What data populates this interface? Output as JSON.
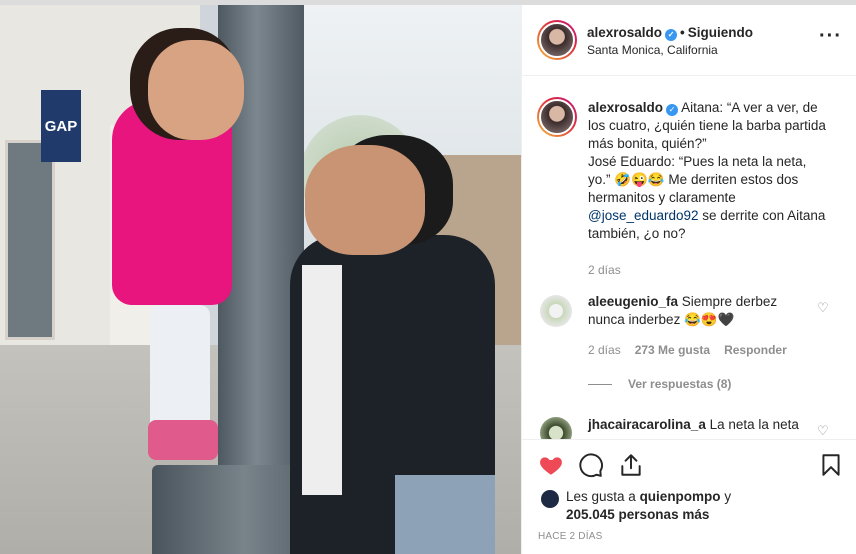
{
  "post": {
    "username": "alexrosaldo",
    "verified": true,
    "follow_status": "Siguiendo",
    "location": "Santa Monica, California",
    "photo_sign_text": "GAP"
  },
  "caption": {
    "username": "alexrosaldo",
    "line1": "Aitana: “A ver a ver, de los cuatro, ¿quién tiene la barba partida más bonita, quién?”",
    "line2": "José Eduardo: “Pues la neta la neta, yo.” 🤣😜😂 Me derriten estos dos hermanitos y claramente",
    "mention": "@jose_eduardo92",
    "line3": " se derrite con Aitana también, ¿o no?",
    "time": "2 días"
  },
  "comments": [
    {
      "username": "aleeugenio_fa",
      "text": " Siempre derbez nunca inderbez 😂😍🖤",
      "time": "2 días",
      "likes": "273 Me gusta",
      "reply": "Responder",
      "view_replies": "Ver respuestas (8)"
    },
    {
      "username": "jhacairacarolina_a",
      "text": " La neta la neta"
    }
  ],
  "actions": {
    "likes_prefix": "Les gusta a ",
    "likes_user": "quienpompo",
    "likes_and": " y",
    "likes_count": "205.045 personas más",
    "post_time": "HACE 2 DÍAS"
  },
  "colors": {
    "like_red": "#ed4956",
    "verified_blue": "#3897f0",
    "mention_blue": "#003569"
  }
}
